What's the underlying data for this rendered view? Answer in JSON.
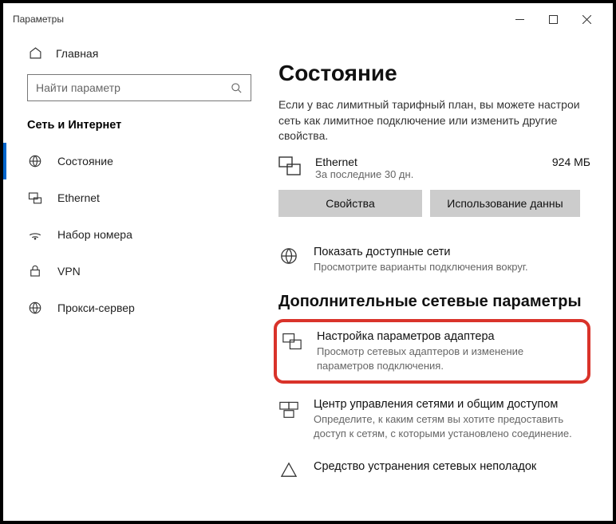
{
  "titlebar": {
    "caption": "Параметры"
  },
  "sidebar": {
    "home": "Главная",
    "search_placeholder": "Найти параметр",
    "section": "Сеть и Интернет",
    "items": [
      {
        "label": "Состояние"
      },
      {
        "label": "Ethernet"
      },
      {
        "label": "Набор номера"
      },
      {
        "label": "VPN"
      },
      {
        "label": "Прокси-сервер"
      }
    ]
  },
  "main": {
    "title": "Состояние",
    "metered_desc": "Если у вас лимитный тарифный план, вы можете настрои сеть как лимитное подключение или изменить другие свойства.",
    "eth": {
      "name": "Ethernet",
      "sub": "За последние 30 дн.",
      "usage": "924 МБ"
    },
    "buttons": {
      "properties": "Свойства",
      "usage": "Использование данны"
    },
    "show_nets": {
      "title": "Показать доступные сети",
      "sub": "Просмотрите варианты подключения вокруг."
    },
    "adv_section": "Дополнительные сетевые параметры",
    "adapter": {
      "title": "Настройка параметров адаптера",
      "sub": "Просмотр сетевых адаптеров и изменение параметров подключения."
    },
    "sharing": {
      "title": "Центр управления сетями и общим доступом",
      "sub": "Определите, к каким сетям вы хотите предоставить доступ к сетям, с которыми установлено соединение."
    },
    "troubleshoot": {
      "title": "Средство устранения сетевых неполадок"
    }
  }
}
